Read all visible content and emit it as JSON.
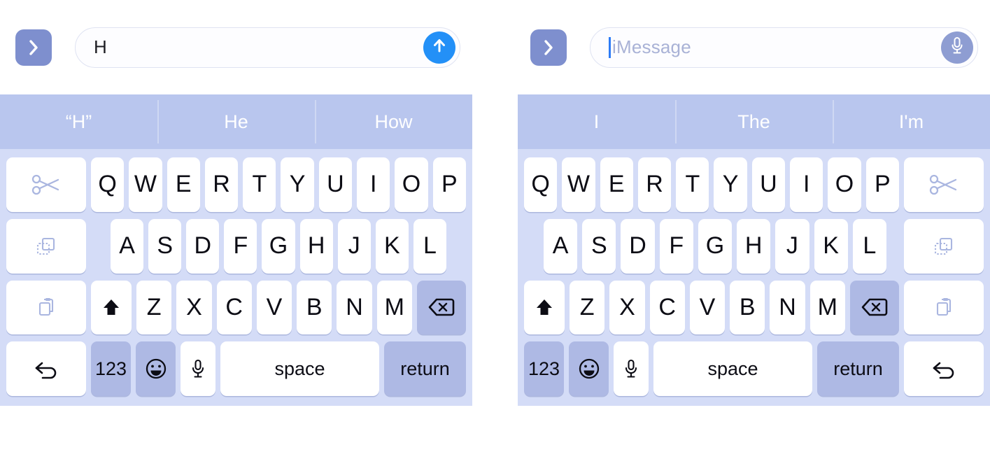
{
  "colors": {
    "panel_bg": "#ffffff",
    "prediction_bar": "#b9c6ee",
    "keyboard_bg": "#d4dcf7",
    "key_white": "#ffffff",
    "key_gray": "#aeb9e4",
    "send_blue": "#2390f7",
    "mic_circle": "#8e9dd2",
    "chevron_btn": "#7e8fce",
    "caret_blue": "#2d7cf6",
    "placeholder_text": "#a9b2d6",
    "key_text": "#0c0c14",
    "prediction_text": "#ffffff",
    "icon_lavender": "#aab6e0"
  },
  "left_panel": {
    "name": "left-keyboard-panel",
    "input_bar": {
      "expand_button_icon": "chevron-right-icon",
      "text_value": "H",
      "placeholder": "",
      "has_caret": false,
      "action_button": {
        "icon": "arrow-up-icon",
        "kind": "send"
      }
    },
    "predictions": [
      "“H”",
      "He",
      "How"
    ],
    "keyboard": {
      "side_column": "left",
      "row1_letters": [
        "Q",
        "W",
        "E",
        "R",
        "T",
        "Y",
        "U",
        "I",
        "O",
        "P"
      ],
      "row2_letters": [
        "A",
        "S",
        "D",
        "F",
        "G",
        "H",
        "J",
        "K",
        "L"
      ],
      "row3_letters": [
        "Z",
        "X",
        "C",
        "V",
        "B",
        "N",
        "M"
      ],
      "side_keys": [
        {
          "icon": "scissors-cut-icon",
          "label": ""
        },
        {
          "icon": "copy-icon",
          "label": ""
        },
        {
          "icon": "paste-icon",
          "label": ""
        },
        {
          "icon": "undo-icon",
          "label": ""
        }
      ],
      "shift_icon": "shift-arrow-up-icon",
      "backspace_icon": "backspace-delete-icon",
      "numeric_label": "123",
      "emoji_icon": "smiley-face-icon",
      "dictation_icon": "microphone-icon",
      "space_label": "space",
      "return_label": "return"
    }
  },
  "right_panel": {
    "name": "right-keyboard-panel",
    "input_bar": {
      "expand_button_icon": "chevron-right-icon",
      "text_value": "",
      "placeholder": "iMessage",
      "has_caret": true,
      "action_button": {
        "icon": "microphone-icon",
        "kind": "dictation"
      }
    },
    "predictions": [
      "I",
      "The",
      "I'm"
    ],
    "keyboard": {
      "side_column": "right",
      "row1_letters": [
        "Q",
        "W",
        "E",
        "R",
        "T",
        "Y",
        "U",
        "I",
        "O",
        "P"
      ],
      "row2_letters": [
        "A",
        "S",
        "D",
        "F",
        "G",
        "H",
        "J",
        "K",
        "L"
      ],
      "row3_letters": [
        "Z",
        "X",
        "C",
        "V",
        "B",
        "N",
        "M"
      ],
      "side_keys": [
        {
          "icon": "scissors-cut-icon",
          "label": ""
        },
        {
          "icon": "copy-icon",
          "label": ""
        },
        {
          "icon": "paste-icon",
          "label": ""
        },
        {
          "icon": "undo-icon",
          "label": ""
        }
      ],
      "shift_icon": "shift-arrow-up-icon",
      "backspace_icon": "backspace-delete-icon",
      "numeric_label": "123",
      "emoji_icon": "smiley-face-icon",
      "dictation_icon": "microphone-icon",
      "space_label": "space",
      "return_label": "return"
    }
  }
}
